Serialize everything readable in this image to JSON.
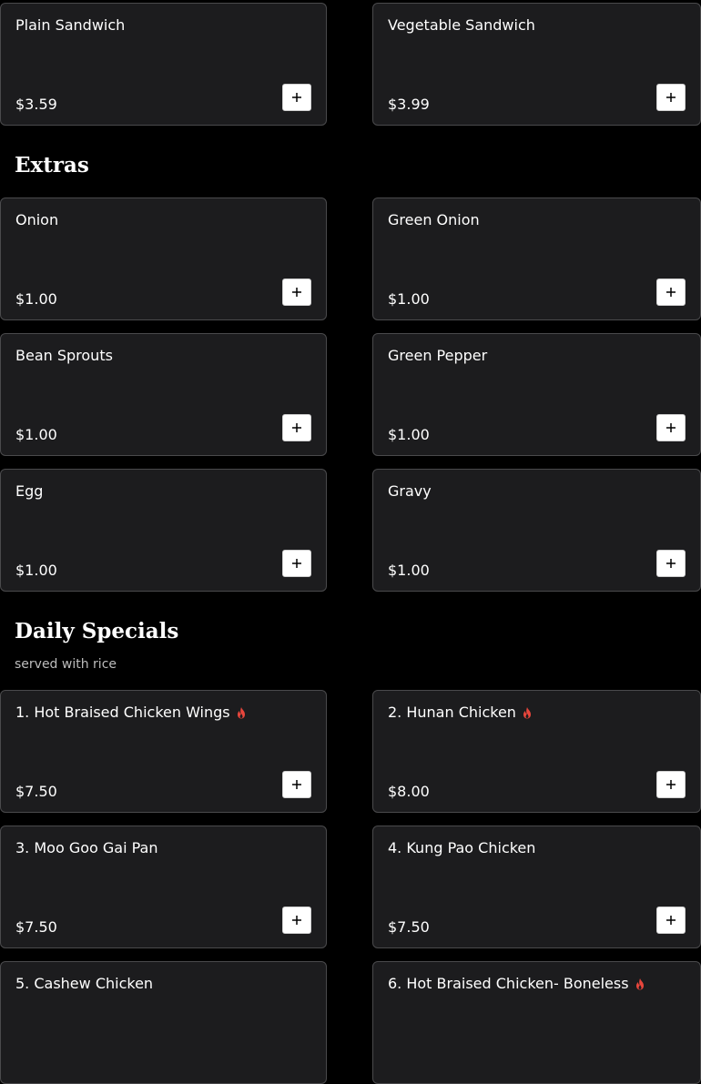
{
  "sections": {
    "extras": {
      "title": "Extras"
    },
    "daily_specials": {
      "title": "Daily Specials",
      "subtitle": "served with rice"
    }
  },
  "items": [
    {
      "name": "Plain Sandwich",
      "price": "$3.59",
      "spicy": false
    },
    {
      "name": "Vegetable Sandwich",
      "price": "$3.99",
      "spicy": false
    },
    {
      "name": "Onion",
      "price": "$1.00",
      "spicy": false
    },
    {
      "name": "Green Onion",
      "price": "$1.00",
      "spicy": false
    },
    {
      "name": "Bean Sprouts",
      "price": "$1.00",
      "spicy": false
    },
    {
      "name": "Green Pepper",
      "price": "$1.00",
      "spicy": false
    },
    {
      "name": "Egg",
      "price": "$1.00",
      "spicy": false
    },
    {
      "name": "Gravy",
      "price": "$1.00",
      "spicy": false
    },
    {
      "name": "1. Hot Braised Chicken Wings",
      "price": "$7.50",
      "spicy": true
    },
    {
      "name": "2. Hunan Chicken",
      "price": "$8.00",
      "spicy": true
    },
    {
      "name": "3. Moo Goo Gai Pan",
      "price": "$7.50",
      "spicy": false
    },
    {
      "name": "4. Kung Pao Chicken",
      "price": "$7.50",
      "spicy": false
    },
    {
      "name": "5. Cashew Chicken",
      "price": "",
      "spicy": false
    },
    {
      "name": "6. Hot Braised Chicken- Boneless",
      "price": "",
      "spicy": true
    }
  ],
  "icons": {
    "add": "plus-icon",
    "spicy": "flame-icon"
  },
  "colors": {
    "background": "#000000",
    "card": "#1c1c1e",
    "border": "#4a4a4c",
    "spicy": "#e8463c",
    "subtitle": "#bdbdbd"
  }
}
